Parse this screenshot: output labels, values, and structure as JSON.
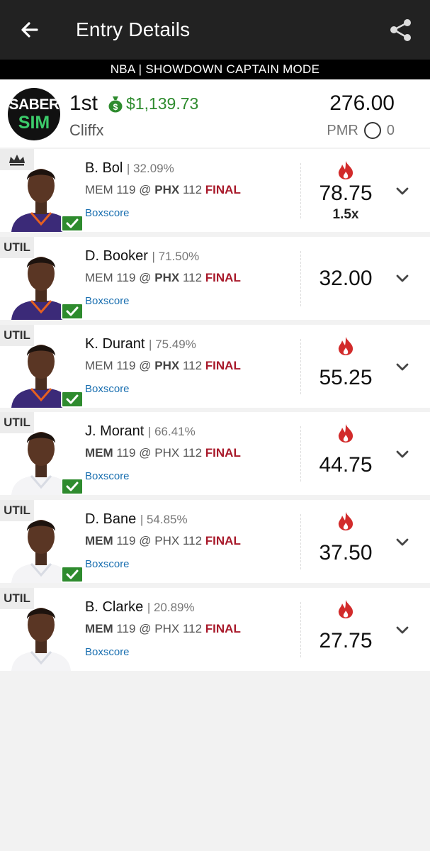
{
  "header": {
    "title": "Entry Details",
    "mode": "NBA | SHOWDOWN CAPTAIN MODE"
  },
  "summary": {
    "logo_line1": "SABER",
    "logo_line2": "SIM",
    "rank": "1st",
    "prize": "$1,139.73",
    "username": "Cliffx",
    "score": "276.00",
    "pmr_label": "PMR",
    "pmr_value": "0"
  },
  "colors": {
    "final": "#a8192a",
    "prize_green": "#2e8b2e",
    "flame": "#d22b2b",
    "link_blue": "#1a6fb0"
  },
  "players": [
    {
      "slot": "",
      "slot_icon": "crown-icon",
      "name": "B. Bol",
      "own": "32.09%",
      "team1": "MEM",
      "score1": "119",
      "at": "@",
      "team2": "PHX",
      "score2": "112",
      "bold_team": "PHX",
      "status": "FINAL",
      "boxscore": "Boxscore",
      "points": "78.75",
      "multiplier": "1.5x",
      "hot": true,
      "checked": true,
      "jersey": "suns"
    },
    {
      "slot": "UTIL",
      "name": "D. Booker",
      "own": "71.50%",
      "team1": "MEM",
      "score1": "119",
      "at": "@",
      "team2": "PHX",
      "score2": "112",
      "bold_team": "PHX",
      "status": "FINAL",
      "boxscore": "Boxscore",
      "points": "32.00",
      "hot": false,
      "checked": true,
      "jersey": "suns"
    },
    {
      "slot": "UTIL",
      "name": "K. Durant",
      "own": "75.49%",
      "team1": "MEM",
      "score1": "119",
      "at": "@",
      "team2": "PHX",
      "score2": "112",
      "bold_team": "PHX",
      "status": "FINAL",
      "boxscore": "Boxscore",
      "points": "55.25",
      "hot": true,
      "checked": true,
      "jersey": "suns"
    },
    {
      "slot": "UTIL",
      "name": "J. Morant",
      "own": "66.41%",
      "team1": "MEM",
      "score1": "119",
      "at": "@",
      "team2": "PHX",
      "score2": "112",
      "bold_team": "MEM",
      "status": "FINAL",
      "boxscore": "Boxscore",
      "points": "44.75",
      "hot": true,
      "checked": true,
      "jersey": "grizzlies"
    },
    {
      "slot": "UTIL",
      "name": "D. Bane",
      "own": "54.85%",
      "team1": "MEM",
      "score1": "119",
      "at": "@",
      "team2": "PHX",
      "score2": "112",
      "bold_team": "MEM",
      "status": "FINAL",
      "boxscore": "Boxscore",
      "points": "37.50",
      "hot": true,
      "checked": true,
      "jersey": "grizzlies"
    },
    {
      "slot": "UTIL",
      "name": "B. Clarke",
      "own": "20.89%",
      "team1": "MEM",
      "score1": "119",
      "at": "@",
      "team2": "PHX",
      "score2": "112",
      "bold_team": "MEM",
      "status": "FINAL",
      "boxscore": "Boxscore",
      "points": "27.75",
      "hot": true,
      "checked": false,
      "jersey": "grizzlies"
    }
  ]
}
